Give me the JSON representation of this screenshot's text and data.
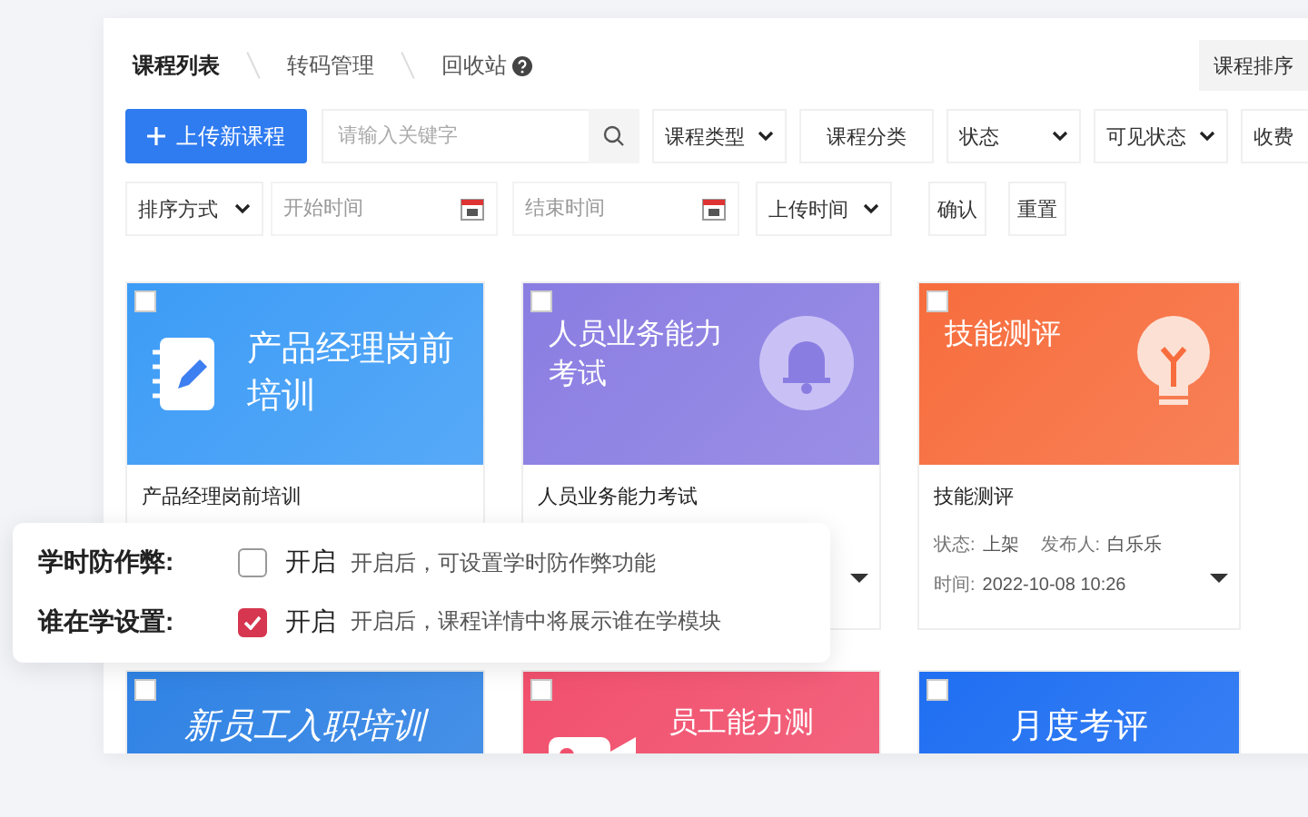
{
  "tabs": [
    {
      "label": "课程列表",
      "selected": true
    },
    {
      "label": "转码管理",
      "selected": false
    },
    {
      "label": "回收站",
      "selected": false,
      "help": true
    }
  ],
  "sort_button": "课程排序",
  "upload_button": "上传新课程",
  "search": {
    "placeholder": "请输入关键字"
  },
  "filters": [
    {
      "kind": "select",
      "label": "课程类型"
    },
    {
      "kind": "button",
      "label": "课程分类"
    },
    {
      "kind": "select",
      "label": "状态"
    },
    {
      "kind": "select",
      "label": "可见状态"
    },
    {
      "kind": "select",
      "label": "收费"
    }
  ],
  "filters2": [
    {
      "kind": "select",
      "label": "排序方式"
    },
    {
      "kind": "date",
      "placeholder": "开始时间"
    },
    {
      "kind": "date",
      "placeholder": "结束时间"
    },
    {
      "kind": "select",
      "label": "上传时间"
    },
    {
      "kind": "button",
      "label": "确认"
    },
    {
      "kind": "button",
      "label": "重置"
    }
  ],
  "cards": [
    {
      "banner": "产品经理岗前培训",
      "title": "产品经理岗前培训",
      "color": "#3d9cf6",
      "kind": "notebook",
      "checked": false
    },
    {
      "banner": "人员业务能力考试",
      "title": "人员业务能力考试",
      "color": "#8a7de2",
      "kind": "bell",
      "checked": false,
      "caret": true
    },
    {
      "banner": "技能测评",
      "title": "技能测评",
      "color": "#f76d3d",
      "kind": "bulb",
      "checked": false,
      "caret": true,
      "meta": [
        {
          "label": "状态:",
          "value": "上架",
          "extra_label": "发布人:",
          "extra_value": "白乐乐"
        },
        {
          "label": "时间:",
          "value": "2022-10-08 10:26"
        }
      ]
    },
    {
      "banner": "新员工入职培训",
      "color": "#2f82e4",
      "kind": "plain",
      "italic": true,
      "checked": false
    },
    {
      "banner": "员工能力测",
      "color": "#f1506d",
      "kind": "camera",
      "checked": false
    },
    {
      "banner": "月度考评",
      "color": "#1f6ff2",
      "kind": "plain",
      "checked": false
    }
  ],
  "settings": [
    {
      "label": "学时防作弊:",
      "checked": false,
      "option": "开启",
      "hint": "开启后，可设置学时防作弊功能"
    },
    {
      "label": "谁在学设置:",
      "checked": true,
      "option": "开启",
      "hint": "开启后，课程详情中将展示谁在学模块"
    }
  ]
}
